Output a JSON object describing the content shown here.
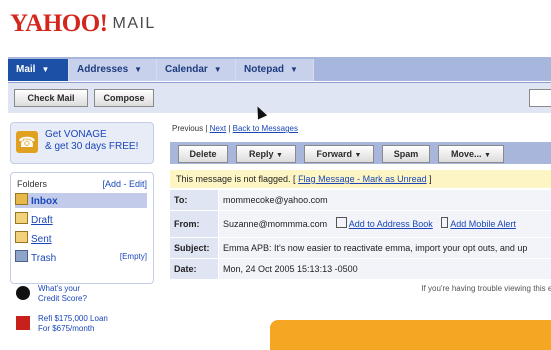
{
  "brand": {
    "logo": "YAHOO!",
    "product": "MAIL"
  },
  "tabs": [
    {
      "label": "Mail",
      "active": true
    },
    {
      "label": "Addresses"
    },
    {
      "label": "Calendar"
    },
    {
      "label": "Notepad"
    }
  ],
  "toolbar": {
    "check_mail": "Check Mail",
    "compose": "Compose"
  },
  "sidebar": {
    "promo": {
      "line1": "Get VONAGE",
      "line2": "& get 30 days FREE!"
    },
    "folders_heading": "Folders",
    "folders_edit": "[Add - Edit]",
    "folders": [
      {
        "label": "Inbox",
        "selected": true
      },
      {
        "label": "Draft"
      },
      {
        "label": "Sent"
      },
      {
        "label": "Trash"
      }
    ],
    "empty_label": "[Empty]",
    "ads": [
      {
        "line1": "What's your",
        "line2": "Credit Score?"
      },
      {
        "line1": "Refi $175,000 Loan",
        "line2": "For $675/month"
      }
    ]
  },
  "message": {
    "nav": {
      "previous": "Previous",
      "sep1": " | ",
      "next": "Next",
      "sep2": " | ",
      "back": "Back to Messages"
    },
    "actions": {
      "delete": "Delete",
      "reply": "Reply",
      "forward": "Forward",
      "spam": "Spam",
      "move": "Move..."
    },
    "notice": {
      "text": "This message is not flagged. [ ",
      "flag_link": "Flag Message - Mark as Unread",
      "close": " ]"
    },
    "headers": {
      "to_label": "To:",
      "to_value": "mommecoke@yahoo.com",
      "from_label": "From:",
      "from_value": "Suzanne@mommma.com",
      "add_address": "Add to Address Book",
      "add_alert": "Add Mobile Alert",
      "subject_label": "Subject:",
      "subject_value": "Emma APB: It's now easier to reactivate emma, import your opt outs, and up",
      "date_label": "Date:",
      "date_value": "Mon, 24 Oct 2005 15:13:13 -0500"
    },
    "trouble_text": "If you're having trouble viewing this em"
  }
}
